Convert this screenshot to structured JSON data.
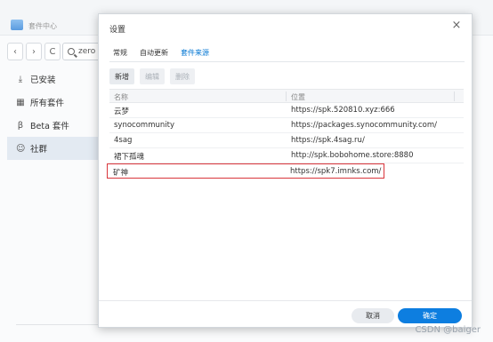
{
  "app": {
    "title": "套件中心",
    "search_value": "zero"
  },
  "sidebar": {
    "items": [
      {
        "label": "已安装",
        "icon": "download-icon"
      },
      {
        "label": "所有套件",
        "icon": "grid-icon"
      },
      {
        "label": "Beta 套件",
        "icon": "beta-icon"
      },
      {
        "label": "社群",
        "icon": "community-icon",
        "active": true
      }
    ]
  },
  "dialog": {
    "title": "设置",
    "tabs": [
      {
        "label": "常规",
        "active": false
      },
      {
        "label": "自动更新",
        "active": false
      },
      {
        "label": "套件来源",
        "active": true
      }
    ],
    "actions": {
      "add": "新增",
      "edit": "编辑",
      "delete": "删除"
    },
    "table": {
      "columns": [
        "名称",
        "位置"
      ],
      "rows": [
        {
          "name": "云梦",
          "location": "https://spk.520810.xyz:666"
        },
        {
          "name": "synocommunity",
          "location": "https://packages.synocommunity.com/"
        },
        {
          "name": "4sag",
          "location": "https://spk.4sag.ru/"
        },
        {
          "name": "裙下孤魂",
          "location": "http://spk.bobohome.store:8880"
        },
        {
          "name": "矿神",
          "location": "https://spk7.imnks.com/",
          "highlighted": true
        }
      ]
    },
    "footer": {
      "cancel": "取消",
      "ok": "确定"
    }
  },
  "watermark": "CSDN @baiger",
  "colors": {
    "accent": "#0d7ee0",
    "highlight_border": "#d9353b",
    "active_tab": "#0a7ad4"
  }
}
